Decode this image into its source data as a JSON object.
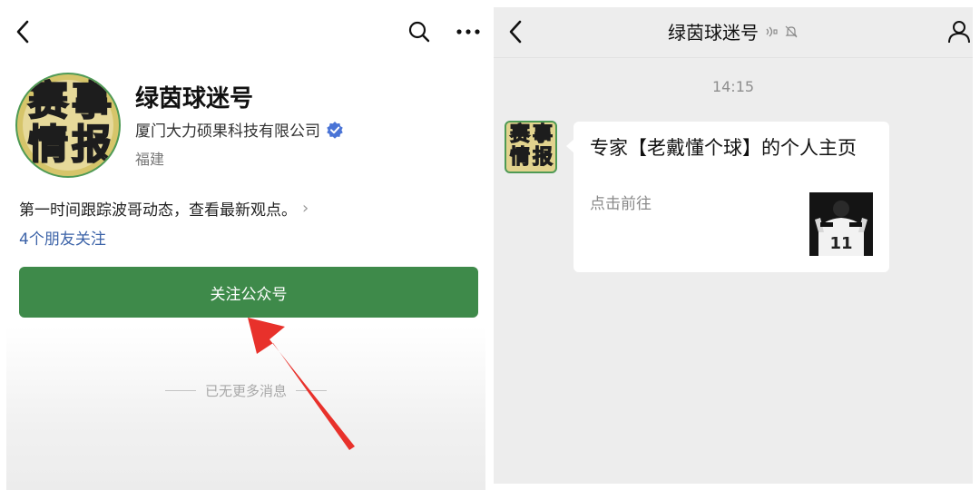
{
  "profile": {
    "account_name": "绿茵球迷号",
    "company": "厦门大力硕果科技有限公司",
    "region": "福建",
    "intro": "第一时间跟踪波哥动态，查看最新观点。",
    "friends_following": "4个朋友关注",
    "follow_button": "关注公众号",
    "no_more": "已无更多消息",
    "logo_text": [
      "赛",
      "事",
      "情",
      "报"
    ]
  },
  "chat": {
    "title": "绿茵球迷号",
    "time": "14:15",
    "card": {
      "title": "专家【老戴懂个球】的个人主页",
      "subtitle": "点击前往",
      "thumb_number": "11"
    }
  },
  "icons": {
    "back": "chevron-left-icon",
    "search": "search-icon",
    "more": "more-dots-icon",
    "verified": "verified-badge-icon",
    "person": "person-icon",
    "mute": "bell-muted-icon",
    "audio": "audio-icon"
  },
  "colors": {
    "follow_button": "#3e8a4a",
    "link": "#3c63a8",
    "verified": "#4a74d6",
    "arrow": "#e8312b",
    "chat_bg": "#ededed"
  }
}
